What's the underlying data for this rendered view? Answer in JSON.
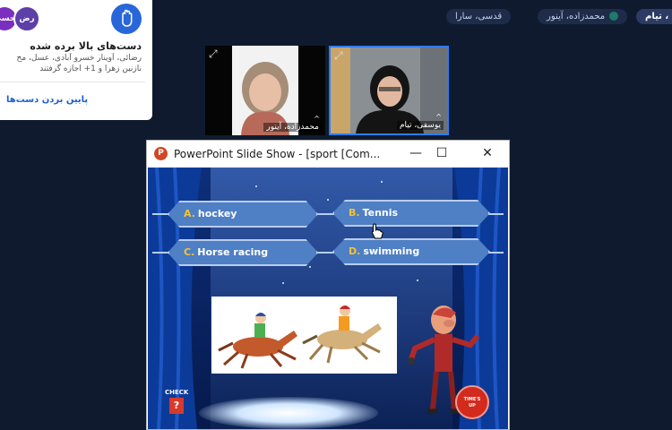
{
  "raised_hands": {
    "title": "دست‌های بالا برده شده",
    "names_line1": "رضائی، آوینار خسرو آبادی، عسل، مح",
    "names_line2": "نازنین زهرا و 1+ اجازه گرفتند",
    "lower_all": "پایین بردن دست‌ها",
    "avatar1": "حسی",
    "avatar2": "رض",
    "hand_icon": "raised-hand-icon",
    "hand_button_color": "#2866d9"
  },
  "participant_chips": [
    {
      "label": "قدسی، سارا"
    },
    {
      "label": "محمدزاده، آینور"
    },
    {
      "label": "، تیام"
    }
  ],
  "video_tiles": [
    {
      "name": "محمدزاده، آینور"
    },
    {
      "name": "یوسفی، تیام"
    }
  ],
  "ppt_window": {
    "title": "PowerPoint Slide Show - [sport [Com...",
    "app_icon": "P",
    "minimize_icon": "—",
    "maximize_icon": "☐",
    "close_icon": "✕"
  },
  "slide": {
    "answers": [
      {
        "letter": "A.",
        "text": "hockey"
      },
      {
        "letter": "B.",
        "text": "Tennis"
      },
      {
        "letter": "C.",
        "text": "Horse racing"
      },
      {
        "letter": "D.",
        "text": "swimming"
      }
    ],
    "check_label": "CHECK",
    "check_symbol": "?",
    "timesup_line1": "TIME'S",
    "timesup_line2": "UP"
  }
}
